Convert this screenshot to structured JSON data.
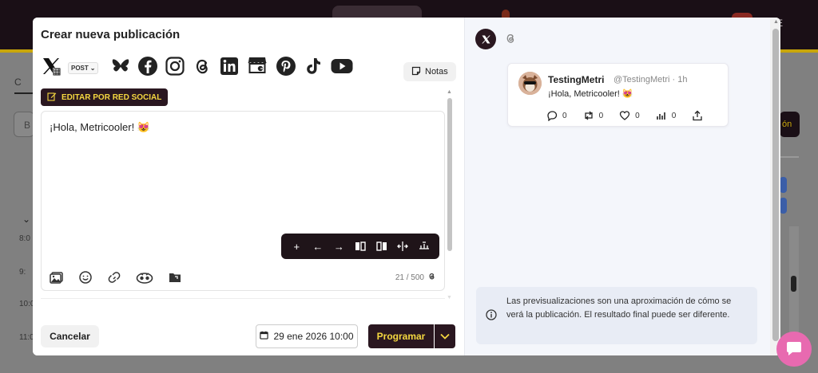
{
  "modal": {
    "title": "Crear nueva publicación",
    "post_type": "POST",
    "notes_label": "Notas",
    "edit_by_network": "EDITAR POR RED SOCIAL",
    "editor_text": "¡Hola, Metricooler! 😻",
    "char_counter": "21 / 500",
    "cancel_label": "Cancelar",
    "date_label": "29 ene 2026 10:00",
    "schedule_label": "Programar",
    "networks": [
      "x-icon",
      "bluesky-icon",
      "facebook-icon",
      "instagram-icon",
      "threads-icon",
      "linkedin-icon",
      "google-business-icon",
      "pinterest-icon",
      "tiktok-icon",
      "youtube-icon"
    ]
  },
  "preview": {
    "name": "TestingMetri",
    "handle": "@TestingMetri · 1h",
    "text": "¡Hola, Metricooler! 😻",
    "reply_count": "0",
    "retweet_count": "0",
    "like_count": "0",
    "views_count": "0",
    "info_text": "Las previsualizaciones son una aproximación de cómo se verá la publicación. El resultado final puede ser diferente."
  },
  "background": {
    "tab": "C",
    "input": "B",
    "times": [
      "8:0",
      "9:",
      "10:0",
      "11:0"
    ],
    "right_button": "ón"
  },
  "colors": {
    "brand_dark": "#2a1720",
    "brand_yellow": "#f5d840",
    "chat_pink": "#e86ab0"
  }
}
